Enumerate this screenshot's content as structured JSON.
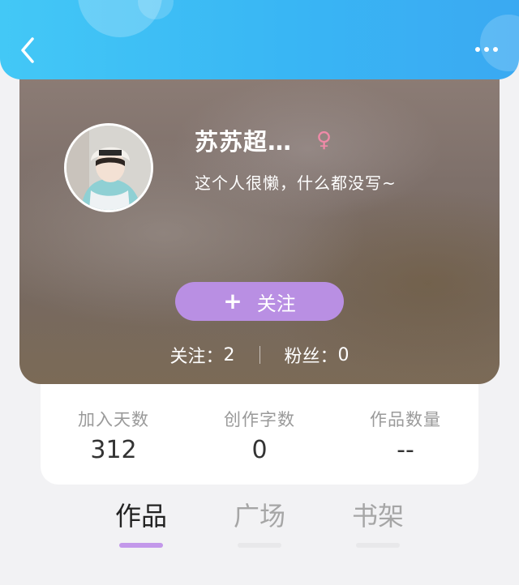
{
  "header": {
    "back_icon": "chevron-left-icon",
    "more_icon": "more-dots-icon"
  },
  "profile": {
    "username": "苏苏超…",
    "gender_symbol": "♀",
    "bio": "这个人很懒，什么都没写~",
    "follow_button": {
      "icon": "+",
      "label": "关注"
    },
    "following": {
      "label": "关注：",
      "value": "2"
    },
    "followers": {
      "label": "粉丝：",
      "value": "0"
    }
  },
  "stats": [
    {
      "label": "加入天数",
      "value": "312"
    },
    {
      "label": "创作字数",
      "value": "0"
    },
    {
      "label": "作品数量",
      "value": "--"
    }
  ],
  "tabs": [
    {
      "label": "作品",
      "active": true
    },
    {
      "label": "广场",
      "active": false
    },
    {
      "label": "书架",
      "active": false
    }
  ],
  "colors": {
    "header_blue": "#3ab4f4",
    "follow_purple": "#b98fe3",
    "tab_indicator": "#c398ea",
    "gender_pink": "#f08aa8"
  }
}
